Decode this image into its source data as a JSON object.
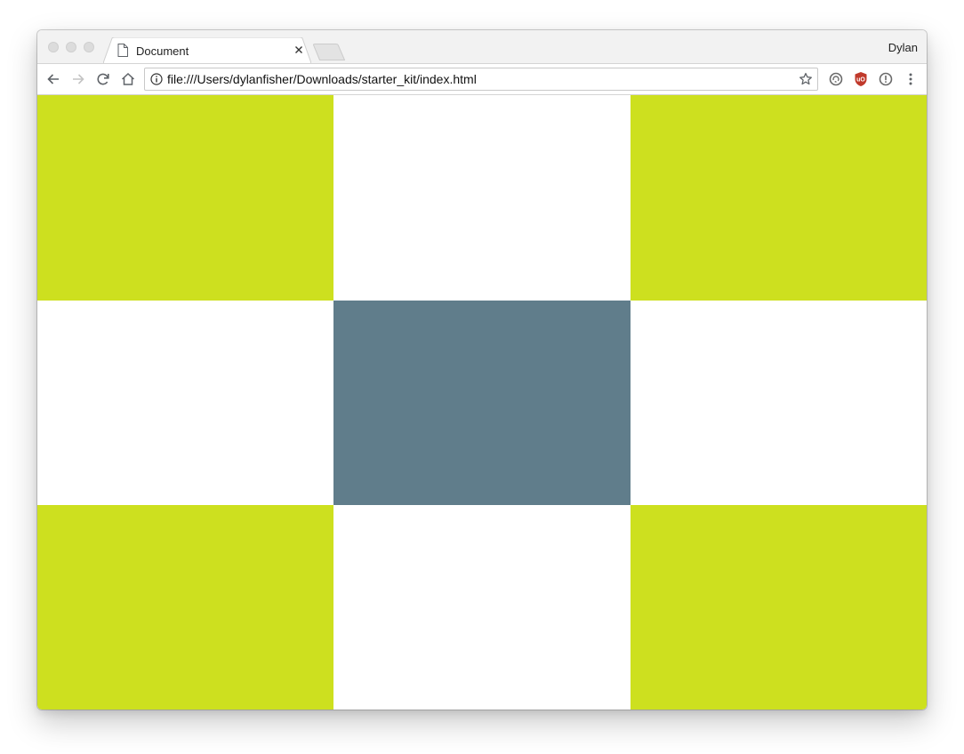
{
  "browser": {
    "tab": {
      "title": "Document",
      "icon": "document-icon",
      "close_icon": "close-icon"
    },
    "profile_name": "Dylan",
    "address_bar": {
      "url": "file:///Users/dylanfisher/Downloads/starter_kit/index.html",
      "site_info_icon": "info-icon",
      "bookmark_icon": "star-icon"
    },
    "toolbar_icons": [
      "back-arrow-icon",
      "forward-arrow-icon",
      "reload-icon",
      "home-icon"
    ],
    "extension_icons": [
      "sync-extension-icon",
      "ublock-origin-icon",
      "extension-info-icon",
      "menu-kebab-icon"
    ]
  },
  "page": {
    "grid": {
      "columns": 3,
      "rows": 3,
      "cells": [
        {
          "name": "cell-1",
          "color": "#cde01f"
        },
        {
          "name": "cell-2",
          "color": "#ffffff"
        },
        {
          "name": "cell-3",
          "color": "#cde01f"
        },
        {
          "name": "cell-4",
          "color": "#ffffff"
        },
        {
          "name": "cell-5",
          "color": "#607d8b"
        },
        {
          "name": "cell-6",
          "color": "#ffffff"
        },
        {
          "name": "cell-7",
          "color": "#cde01f"
        },
        {
          "name": "cell-8",
          "color": "#ffffff"
        },
        {
          "name": "cell-9",
          "color": "#cde01f"
        }
      ]
    }
  },
  "colors": {
    "accent_lime": "#cde01f",
    "center_slate": "#607d8b",
    "ublock_red": "#c0392b"
  }
}
